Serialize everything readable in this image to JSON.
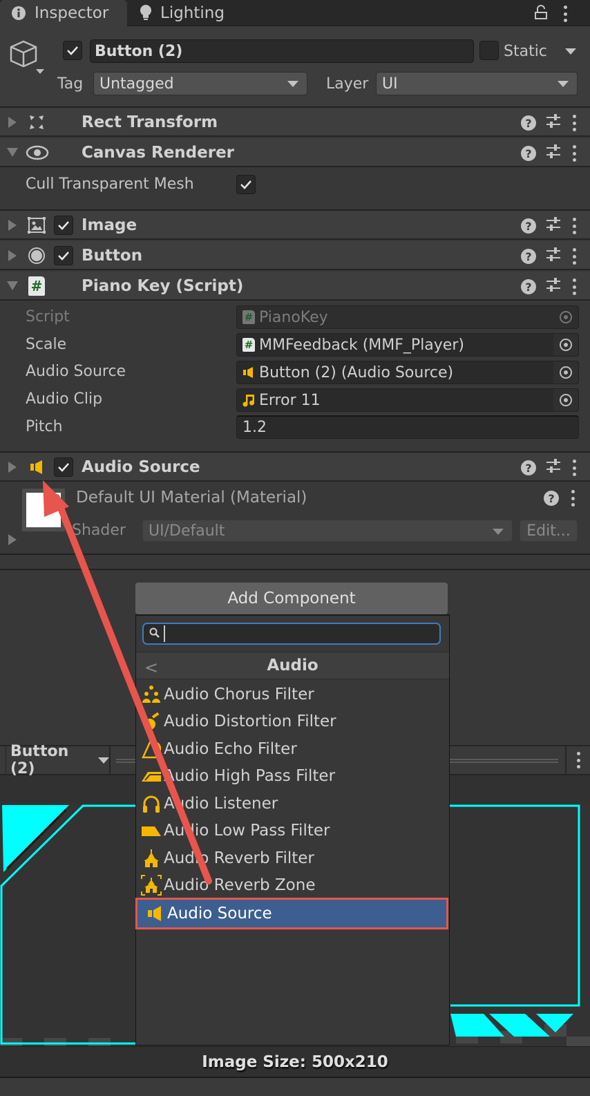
{
  "tabs": [
    {
      "label": "Inspector",
      "icon": "info-icon",
      "active": true
    },
    {
      "label": "Lighting",
      "icon": "lightbulb-icon",
      "active": false
    }
  ],
  "header": {
    "object_name": "Button (2)",
    "active": true,
    "static_label": "Static",
    "static": false,
    "tag_label": "Tag",
    "tag_value": "Untagged",
    "layer_label": "Layer",
    "layer_value": "UI"
  },
  "components": {
    "rect_transform": {
      "title": "Rect Transform",
      "expanded": false
    },
    "canvas_renderer": {
      "title": "Canvas Renderer",
      "expanded": true,
      "cull_label": "Cull Transparent Mesh",
      "cull_value": true
    },
    "image": {
      "title": "Image",
      "enabled": true,
      "expanded": false
    },
    "button": {
      "title": "Button",
      "enabled": true,
      "expanded": false
    },
    "piano_key": {
      "title": "Piano Key (Script)",
      "expanded": true,
      "props": {
        "script_label": "Script",
        "script_value": "PianoKey",
        "scale_label": "Scale",
        "scale_value": "MMFeedback (MMF_Player)",
        "audio_source_label": "Audio Source",
        "audio_source_value": "Button (2) (Audio Source)",
        "audio_clip_label": "Audio Clip",
        "audio_clip_value": "Error 11",
        "pitch_label": "Pitch",
        "pitch_value": "1.2"
      }
    },
    "audio_source": {
      "title": "Audio Source",
      "enabled": true,
      "expanded": false
    }
  },
  "material": {
    "title": "Default UI Material (Material)",
    "shader_label": "Shader",
    "shader_value": "UI/Default",
    "edit_label": "Edit..."
  },
  "add_component": {
    "button_label": "Add Component",
    "search_value": "",
    "category": "Audio",
    "items": [
      {
        "label": "Audio Chorus Filter",
        "icon": "chorus-filter-icon"
      },
      {
        "label": "Audio Distortion Filter",
        "icon": "distortion-filter-icon"
      },
      {
        "label": "Audio Echo Filter",
        "icon": "echo-filter-icon"
      },
      {
        "label": "Audio High Pass Filter",
        "icon": "high-pass-filter-icon"
      },
      {
        "label": "Audio Listener",
        "icon": "headphones-icon"
      },
      {
        "label": "Audio Low Pass Filter",
        "icon": "low-pass-filter-icon"
      },
      {
        "label": "Audio Reverb Filter",
        "icon": "reverb-filter-icon"
      },
      {
        "label": "Audio Reverb Zone",
        "icon": "reverb-zone-icon"
      },
      {
        "label": "Audio Source",
        "icon": "speaker-icon",
        "selected": true
      }
    ]
  },
  "preview": {
    "object_label": "Button (2)",
    "image_size": "Image Size: 500x210",
    "accent_color": "#00ffff"
  },
  "colors": {
    "selection": "#3d5f8f",
    "annotation": "#e8554c",
    "audio_icon": "#f5b800",
    "search_focus": "#3d7bc4"
  }
}
